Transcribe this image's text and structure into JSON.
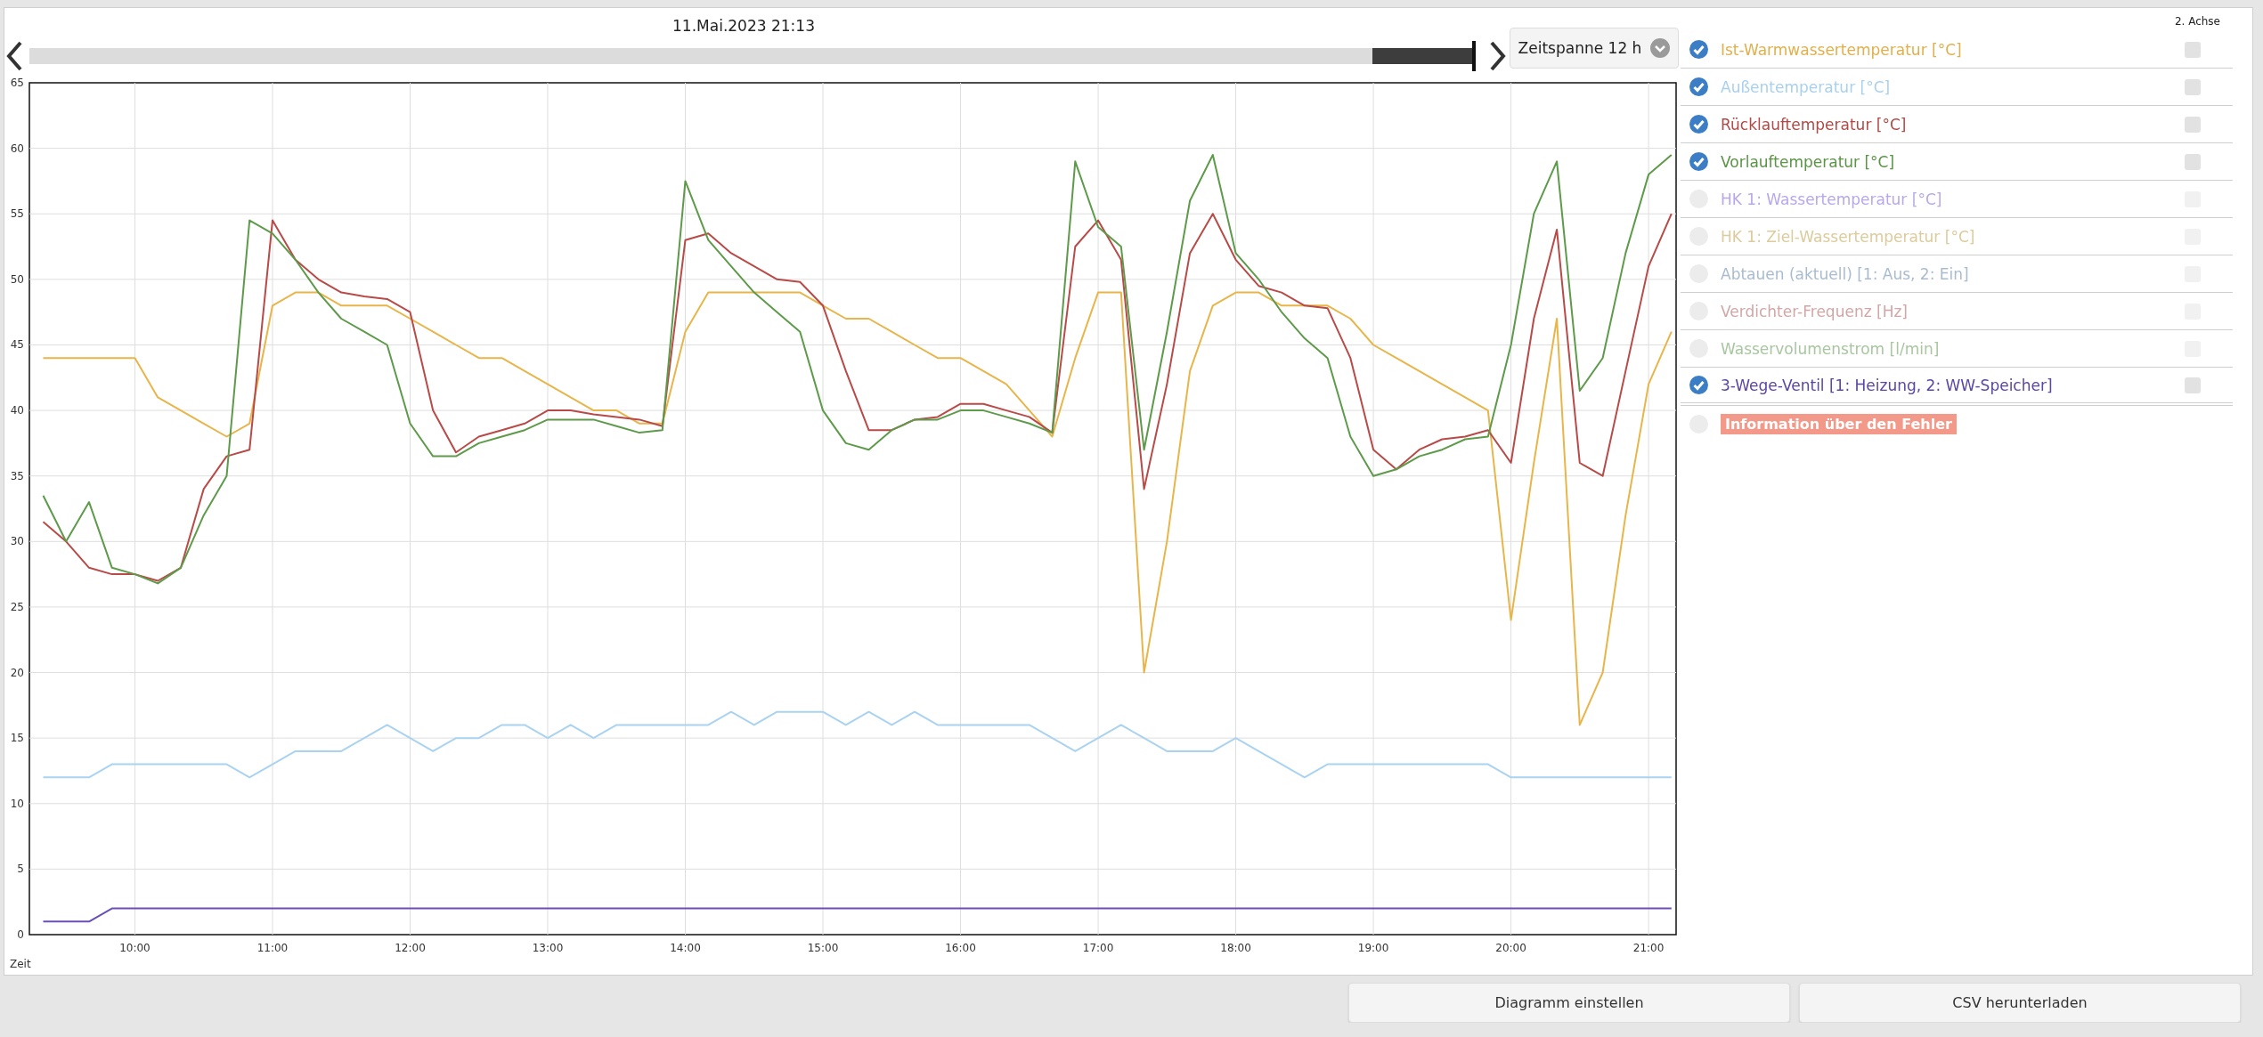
{
  "header": {
    "date": "11.Mai.2023 21:13",
    "slider": {
      "level": 1
    },
    "timespan": "Zeitspanne 12 h"
  },
  "chart": {
    "chart_data": {
      "type": "line",
      "xlabel": "Zeit",
      "grid": true,
      "x": [
        560,
        570,
        580,
        590,
        600,
        610,
        620,
        630,
        640,
        650,
        660,
        670,
        680,
        690,
        700,
        710,
        720,
        730,
        740,
        750,
        760,
        770,
        780,
        790,
        800,
        810,
        820,
        830,
        840,
        850,
        860,
        870,
        880,
        890,
        900,
        910,
        920,
        930,
        940,
        950,
        960,
        970,
        980,
        990,
        1000,
        1010,
        1020,
        1030,
        1040,
        1050,
        1060,
        1070,
        1080,
        1090,
        1100,
        1110,
        1120,
        1130,
        1140,
        1150,
        1160,
        1170,
        1180,
        1190,
        1200,
        1210,
        1220,
        1230,
        1240,
        1250,
        1260,
        1270
      ],
      "xlim": [
        554,
        1272
      ],
      "ylim": [
        0,
        65
      ],
      "xticks": [
        {
          "value": 600,
          "label": "10:00"
        },
        {
          "value": 660,
          "label": "11:00"
        },
        {
          "value": 720,
          "label": "12:00"
        },
        {
          "value": 780,
          "label": "13:00"
        },
        {
          "value": 840,
          "label": "14:00"
        },
        {
          "value": 900,
          "label": "15:00"
        },
        {
          "value": 960,
          "label": "16:00"
        },
        {
          "value": 1020,
          "label": "17:00"
        },
        {
          "value": 1080,
          "label": "18:00"
        },
        {
          "value": 1140,
          "label": "19:00"
        },
        {
          "value": 1200,
          "label": "20:00"
        },
        {
          "value": 1260,
          "label": "21:00"
        }
      ],
      "yticks": [
        0,
        5,
        10,
        15,
        20,
        25,
        30,
        35,
        40,
        45,
        50,
        55,
        60,
        65
      ],
      "series": [
        {
          "color": "#e8b54a",
          "values": [
            44,
            44,
            44,
            44,
            44,
            41,
            40,
            39,
            38,
            39,
            48,
            49,
            49,
            48,
            48,
            48,
            47,
            46,
            45,
            44,
            44,
            43,
            42,
            41,
            40,
            40,
            39,
            39,
            46,
            49,
            49,
            49,
            49,
            49,
            48,
            47,
            47,
            46,
            45,
            44,
            44,
            43,
            42,
            40,
            38,
            44,
            49,
            49,
            20,
            30,
            43,
            48,
            49,
            49,
            48,
            48,
            48,
            47,
            45,
            44,
            43,
            42,
            41,
            40,
            24,
            36,
            47,
            16,
            20,
            32,
            42,
            46
          ]
        },
        {
          "color": "#a9d3f0",
          "values": [
            12,
            12,
            12,
            13,
            13,
            13,
            13,
            13,
            13,
            12,
            13,
            14,
            14,
            14,
            15,
            16,
            15,
            14,
            15,
            15,
            16,
            16,
            15,
            16,
            15,
            16,
            16,
            16,
            16,
            16,
            17,
            16,
            17,
            17,
            17,
            16,
            17,
            16,
            17,
            16,
            16,
            16,
            16,
            16,
            15,
            14,
            15,
            16,
            15,
            14,
            14,
            14,
            15,
            14,
            13,
            12,
            13,
            13,
            13,
            13,
            13,
            13,
            13,
            13,
            12,
            12,
            12,
            12,
            12,
            12,
            12,
            12
          ]
        },
        {
          "color": "#b84a48",
          "values": [
            31.5,
            30,
            28,
            27.5,
            27.5,
            27,
            28,
            34,
            36.5,
            37,
            54.5,
            51.5,
            50,
            49,
            48.7,
            48.5,
            47.5,
            40,
            36.8,
            38,
            38.5,
            39,
            40,
            40,
            39.7,
            39.5,
            39.3,
            38.8,
            53,
            53.5,
            52,
            51,
            50,
            49.8,
            48,
            43,
            38.5,
            38.5,
            39.3,
            39.5,
            40.5,
            40.5,
            40,
            39.5,
            38.3,
            52.5,
            54.5,
            51.5,
            34,
            42,
            52,
            55,
            51.5,
            49.5,
            49,
            48,
            47.8,
            44,
            37,
            35.5,
            37,
            37.8,
            38,
            38.5,
            36,
            47,
            53.8,
            36,
            35,
            43,
            51,
            55
          ]
        },
        {
          "color": "#5d9a4a",
          "values": [
            33.5,
            30,
            33,
            28,
            27.5,
            26.8,
            28,
            32,
            35,
            54.5,
            53.5,
            51.5,
            49,
            47,
            46,
            45,
            39,
            36.5,
            36.5,
            37.5,
            38,
            38.5,
            39.3,
            39.3,
            39.3,
            38.8,
            38.3,
            38.5,
            57.5,
            53,
            51,
            49,
            47.5,
            46,
            40,
            37.5,
            37,
            38.5,
            39.3,
            39.3,
            40,
            40,
            39.5,
            39,
            38.3,
            59,
            54,
            52.5,
            37,
            46,
            56,
            59.5,
            52,
            50,
            47.5,
            45.5,
            44,
            38,
            35,
            35.5,
            36.5,
            37,
            37.8,
            38,
            45,
            55,
            59,
            41.5,
            44,
            52,
            58,
            59.5
          ]
        },
        {
          "color": "#6a4fb8",
          "values": [
            1,
            1,
            1,
            2,
            2,
            2,
            2,
            2,
            2,
            2,
            2,
            2,
            2,
            2,
            2,
            2,
            2,
            2,
            2,
            2,
            2,
            2,
            2,
            2,
            2,
            2,
            2,
            2,
            2,
            2,
            2,
            2,
            2,
            2,
            2,
            2,
            2,
            2,
            2,
            2,
            2,
            2,
            2,
            2,
            2,
            2,
            2,
            2,
            2,
            2,
            2,
            2,
            2,
            2,
            2,
            2,
            2,
            2,
            2,
            2,
            2,
            2,
            2,
            2,
            2,
            2,
            2,
            2,
            2,
            2,
            2,
            2
          ]
        }
      ]
    }
  },
  "legend": {
    "axis_header": "2. Achse",
    "items": [
      {
        "kind": "series",
        "label": "Ist-Warmwassertemperatur [°C]",
        "color": "#e0b04c",
        "checked": true,
        "axis2": false
      },
      {
        "kind": "series",
        "label": "Außentemperatur [°C]",
        "color": "#a9d0ee",
        "checked": true,
        "axis2": false
      },
      {
        "kind": "series",
        "label": "Rücklauftemperatur [°C]",
        "color": "#b04a46",
        "checked": true,
        "axis2": false
      },
      {
        "kind": "series",
        "label": "Vorlauftemperatur [°C]",
        "color": "#5a9445",
        "checked": true,
        "axis2": false
      },
      {
        "kind": "series",
        "label": "HK 1: Wassertemperatur [°C]",
        "color": "#b8a8ea",
        "checked": false,
        "axis2": false
      },
      {
        "kind": "series",
        "label": "HK 1: Ziel-Wassertemperatur [°C]",
        "color": "#dccb9c",
        "checked": false,
        "axis2": false
      },
      {
        "kind": "series",
        "label": "Abtauen (aktuell) [1: Aus, 2: Ein]",
        "color": "#a9bccf",
        "checked": false,
        "axis2": false
      },
      {
        "kind": "series",
        "label": "Verdichter-Frequenz [Hz]",
        "color": "#d2a6a6",
        "checked": false,
        "axis2": false
      },
      {
        "kind": "series",
        "label": "Wasservolumenstrom [l/min]",
        "color": "#a8c6a0",
        "checked": false,
        "axis2": false
      },
      {
        "kind": "series",
        "label": "3-Wege-Ventil [1: Heizung, 2: WW-Speicher]",
        "color": "#5b46a6",
        "checked": true,
        "axis2": false
      },
      {
        "kind": "error",
        "label": "Information über den Fehler",
        "color": "#f2998a",
        "checked": false
      }
    ]
  },
  "buttons": [
    "Diagramm einstellen",
    "CSV herunterladen"
  ]
}
